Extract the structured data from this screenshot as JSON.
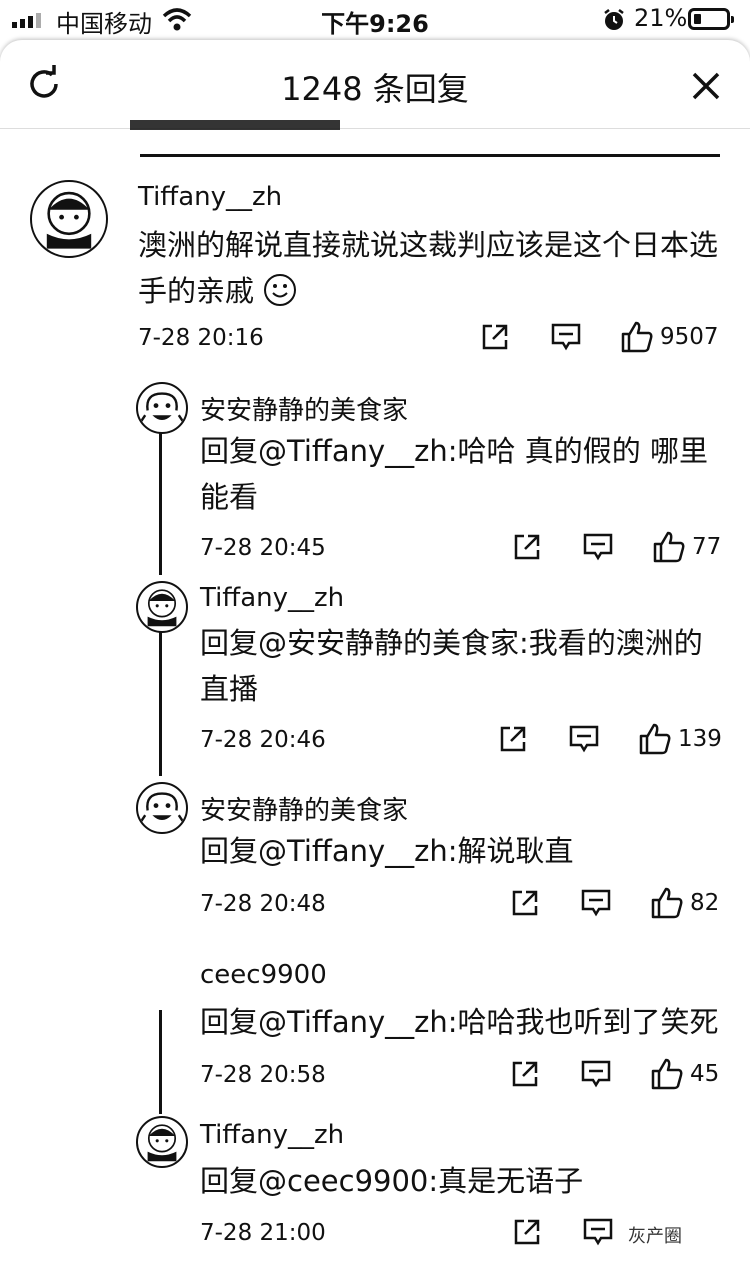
{
  "status_bar": {
    "carrier": "中国移动",
    "time": "下午9:26",
    "battery_pct": "21%",
    "signal_icon": "signal-bars-icon",
    "wifi_icon": "wifi-icon",
    "alarm_icon": "alarm-icon",
    "battery_icon": "battery-icon"
  },
  "header": {
    "title": "1248 条回复",
    "refresh_icon": "refresh-icon",
    "close_icon": "close-icon"
  },
  "main_comment": {
    "author": "Tiffany__zh",
    "text": "澳洲的解说直接就说这裁判应该是这个日本选手的亲戚",
    "emoji": "smiley-icon",
    "time": "7-28 20:16",
    "likes": "9507"
  },
  "replies": [
    {
      "author": "安安静静的美食家",
      "text": "回复@Tiffany__zh:哈哈 真的假的 哪里能看",
      "time": "7-28 20:45",
      "likes": "77"
    },
    {
      "author": "Tiffany__zh",
      "text": "回复@安安静静的美食家:我看的澳洲的直播",
      "time": "7-28 20:46",
      "likes": "139"
    },
    {
      "author": "安安静静的美食家",
      "text": "回复@Tiffany__zh:解说耿直",
      "time": "7-28 20:48",
      "likes": "82"
    },
    {
      "author": "ceec9900",
      "text": "回复@Tiffany__zh:哈哈我也听到了笑死",
      "time": "7-28 20:58",
      "likes": "45"
    },
    {
      "author": "Tiffany__zh",
      "text": "回复@ceec9900:真是无语子",
      "time": "7-28 21:00",
      "likes": ""
    }
  ],
  "watermark": "灰产圈",
  "colors": {
    "text": "#111111",
    "background": "#ffffff"
  }
}
